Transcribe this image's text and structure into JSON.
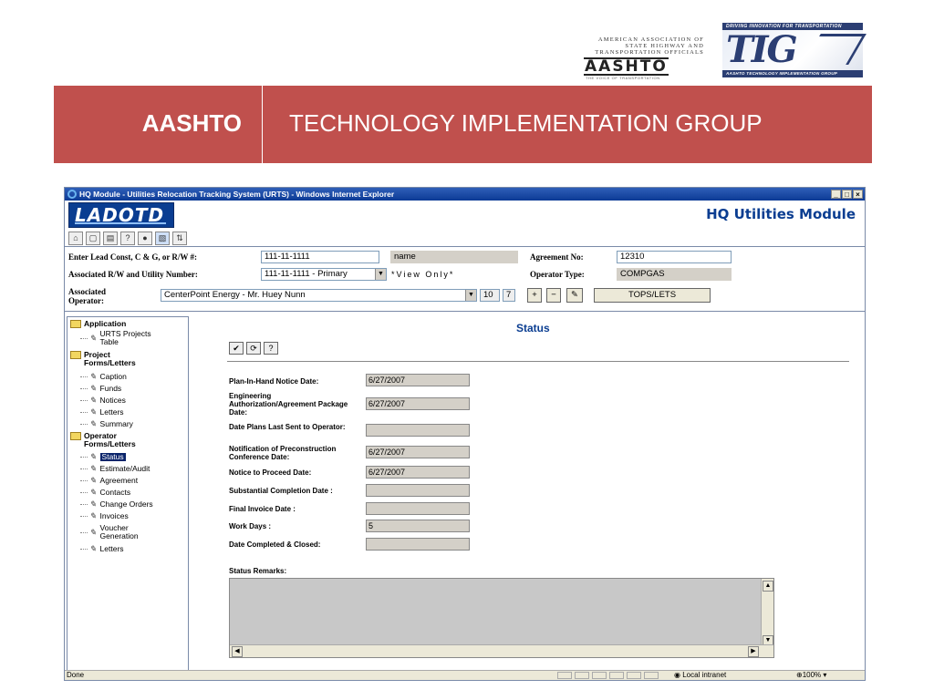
{
  "slide": {
    "aashto_logo": {
      "line1": "AMERICAN ASSOCIATION OF",
      "line2": "STATE HIGHWAY AND",
      "line3": "TRANSPORTATION OFFICIALS",
      "word": "AASHTO",
      "tagline": "THE VOICE OF TRANSPORTATION"
    },
    "tig_logo": {
      "top": "DRIVING INNOVATION FOR TRANSPORTATION",
      "mark": "TIG",
      "bottom": "AASHTO TECHNOLOGY IMPLEMENTATION GROUP"
    },
    "band_left": "AASHTO",
    "band_right": "TECHNOLOGY IMPLEMENTATION GROUP",
    "colors": {
      "band": "#c0504d",
      "navy": "#0a3d91"
    }
  },
  "window": {
    "title": "HQ Module - Utilities Relocation Tracking System (URTS) - Windows Internet Explorer",
    "controls": [
      "_",
      "□",
      "×"
    ],
    "logo": "LADOTD",
    "module_title": "HQ Utilities Module",
    "toolbar_icons": [
      "home-icon",
      "folder-icon",
      "print-icon",
      "help-icon",
      "user-icon",
      "image-icon",
      "sort-icon"
    ]
  },
  "form": {
    "lead_label": "Enter Lead Const, C & G, or R/W #:",
    "lead_value": "111-11-1111",
    "name_value": "name",
    "agreement_label": "Agreement No:",
    "agreement_value": "12310",
    "assoc_label": "Associated R/W and Utility Number:",
    "assoc_value": "111-11-1111 - Primary",
    "view_only": "*View Only*",
    "operator_type_label": "Operator Type:",
    "operator_type_value": "COMPGAS",
    "operator_label_1": "Associated",
    "operator_label_2": "Operator:",
    "operator_value": "CenterPoint Energy - Mr. Huey Nunn",
    "count_a": "10",
    "count_b": "7",
    "tops_button": "TOPS/LETS"
  },
  "sidebar": {
    "application": "Application",
    "urts": "URTS Projects Table",
    "project_forms": "Project Forms/Letters",
    "project_items": [
      "Caption",
      "Funds",
      "Notices",
      "Letters",
      "Summary"
    ],
    "operator_forms": "Operator Forms/Letters",
    "operator_items": [
      "Status",
      "Estimate/Audit",
      "Agreement",
      "Contacts",
      "Change Orders",
      "Invoices",
      "Voucher Generation",
      "Letters"
    ]
  },
  "status": {
    "title": "Status",
    "fields": [
      {
        "label": "Plan-In-Hand Notice Date:",
        "value": "6/27/2007"
      },
      {
        "label": "Engineering Authorization/Agreement Package Date:",
        "value": "6/27/2007"
      },
      {
        "label": "Date Plans Last Sent to Operator:",
        "value": ""
      },
      {
        "label": "Notification of Preconstruction Conference Date:",
        "value": "6/27/2007"
      },
      {
        "label": "Notice to Proceed Date:",
        "value": "6/27/2007"
      },
      {
        "label": "Substantial Completion Date :",
        "value": ""
      },
      {
        "label": "Final Invoice Date :",
        "value": ""
      },
      {
        "label": "Work Days :",
        "value": "5"
      },
      {
        "label": "Date Completed & Closed:",
        "value": ""
      }
    ],
    "remarks_label": "Status Remarks:"
  },
  "statusbar": {
    "left": "Done",
    "zone": "Local intranet",
    "zoom": "100%"
  }
}
